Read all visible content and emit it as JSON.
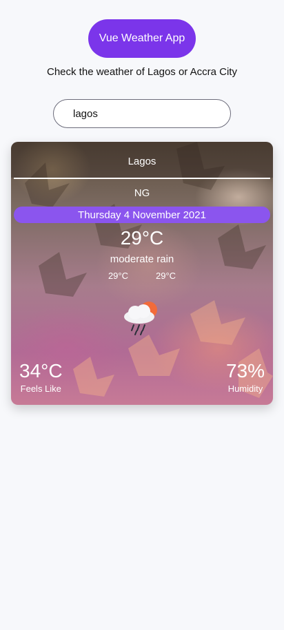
{
  "header": {
    "app_title": "Vue Weather App",
    "subtitle": "Check the weather of Lagos or Accra City"
  },
  "search": {
    "value": "lagos",
    "placeholder": ""
  },
  "weather": {
    "city": "Lagos",
    "country": "NG",
    "date": "Thursday 4 November 2021",
    "temperature": "29°C",
    "description": "moderate rain",
    "temp_min": "29°C",
    "temp_max": "29°C",
    "icon": "cloud-sun-rain-icon",
    "feels_like_value": "34°C",
    "feels_like_label": "Feels Like",
    "humidity_value": "73%",
    "humidity_label": "Humidity"
  },
  "colors": {
    "accent": "#7b35ea",
    "date_pill": "#8b55ee",
    "page_bg": "#f7f8fb"
  }
}
